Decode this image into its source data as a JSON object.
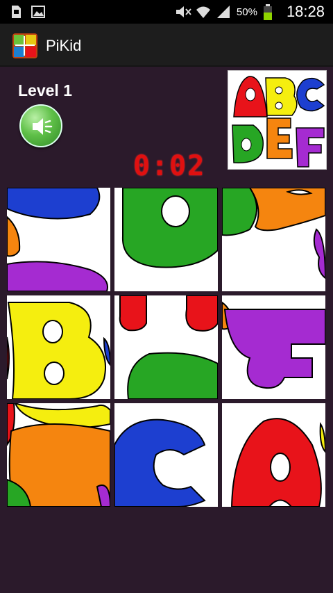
{
  "status_bar": {
    "battery_percent": "50%",
    "time": "18:28",
    "icons": [
      "sd-card-icon",
      "image-icon",
      "mute-icon",
      "wifi-icon",
      "signal-icon",
      "battery-icon"
    ]
  },
  "action_bar": {
    "title": "PiKid",
    "icon": "puzzle-app-icon"
  },
  "game": {
    "level": "Level 1",
    "timer": "0:02",
    "sound_icon": "speaker-icon",
    "preview_letters": [
      "A",
      "B",
      "C",
      "D",
      "E",
      "F"
    ],
    "tiles_count": 9,
    "colors": {
      "red": "#e8131a",
      "blue": "#1d3fd0",
      "green": "#27a624",
      "yellow": "#f5ee0f",
      "orange": "#f5850f",
      "purple": "#a52bd1",
      "background": "#2b1a2b",
      "timer": "#e01010"
    }
  }
}
